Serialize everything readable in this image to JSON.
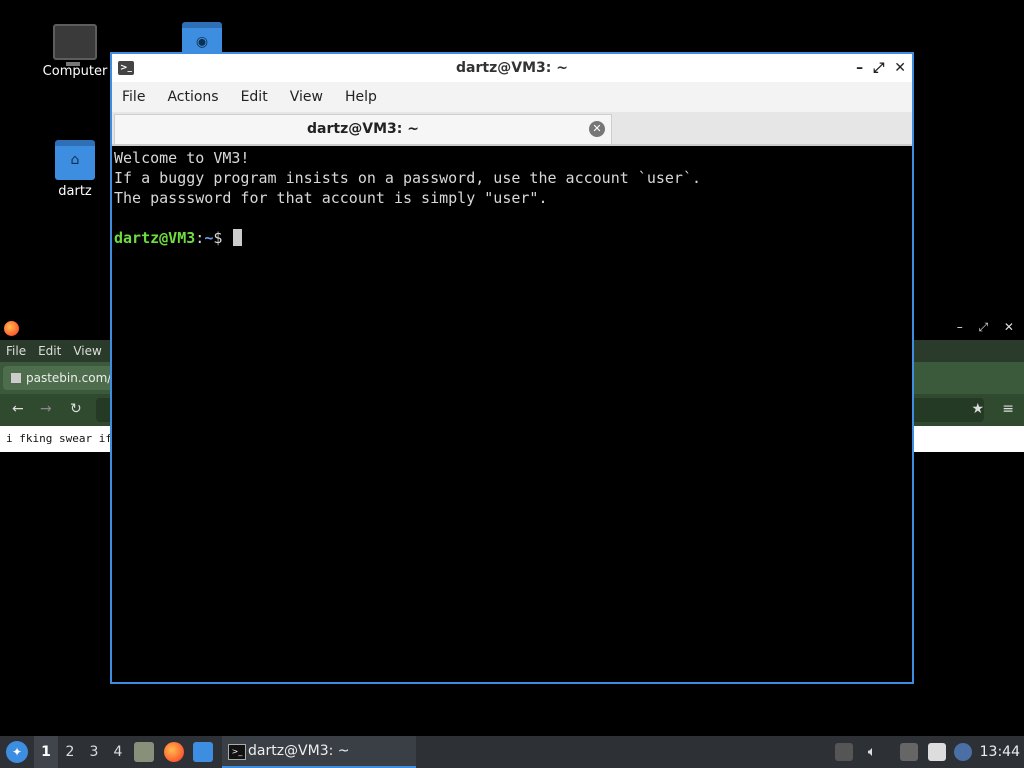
{
  "desktop": {
    "icons": [
      {
        "label": "Computer",
        "icon": "computer-icon"
      },
      {
        "label": "",
        "icon": "network-folder-icon"
      },
      {
        "label": "dartz",
        "icon": "home-folder-icon"
      }
    ]
  },
  "firefox": {
    "menu": [
      "File",
      "Edit",
      "View"
    ],
    "tab_title": "pastebin.com/ra",
    "content_text": "i fking swear if y"
  },
  "terminal": {
    "window_title": "dartz@VM3: ~",
    "menu": [
      "File",
      "Actions",
      "Edit",
      "View",
      "Help"
    ],
    "tab_title": "dartz@VM3: ~",
    "lines": [
      "Welcome to VM3!",
      "If a buggy program insists on a password, use the account `user`.",
      "The passsword for that account is simply \"user\"."
    ],
    "prompt_user": "dartz@VM3",
    "prompt_sep": ":",
    "prompt_path": "~",
    "prompt_symbol": "$ "
  },
  "taskbar": {
    "workspaces": [
      "1",
      "2",
      "3",
      "4"
    ],
    "active_workspace": "1",
    "task_label": "dartz@VM3: ~",
    "clock": "13:44"
  },
  "colors": {
    "accent": "#3d8ee0",
    "prompt_user": "#6fdc3f",
    "prompt_path": "#6f9ff0"
  }
}
